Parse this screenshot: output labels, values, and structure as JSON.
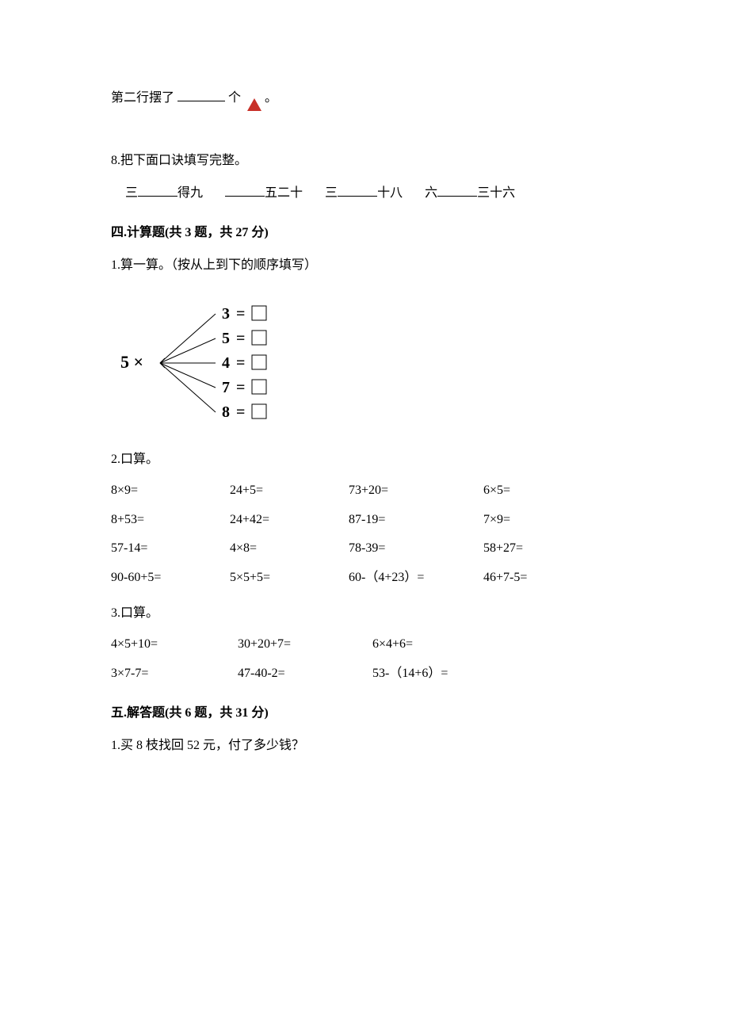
{
  "q7_tail": {
    "prefix": "第二行摆了",
    "suffix": "个",
    "period": "。"
  },
  "q8": {
    "prompt": "8.把下面口诀填写完整。",
    "items": [
      {
        "a": "三",
        "b": "得九"
      },
      {
        "a": "",
        "b": "五二十"
      },
      {
        "a": "三",
        "b": "十八"
      },
      {
        "a": "六",
        "b": "三十六"
      }
    ]
  },
  "sec4": {
    "title": "四.计算题(共 3 题，共 27 分)",
    "q1": {
      "prompt": "1.算一算。（按从上到下的顺序填写）",
      "left": "5 ×",
      "rows": [
        "3",
        "5",
        "4",
        "7",
        "8"
      ]
    },
    "q2": {
      "prompt": "2.口算。",
      "rows": [
        [
          "8×9=",
          "24+5=",
          "73+20=",
          "6×5="
        ],
        [
          "8+53=",
          "24+42=",
          "87-19=",
          "7×9="
        ],
        [
          "57-14=",
          "4×8=",
          "78-39=",
          "58+27="
        ],
        [
          "90-60+5=",
          "5×5+5=",
          "60-（4+23）=",
          "46+7-5="
        ]
      ]
    },
    "q3": {
      "prompt": "3.口算。",
      "rows": [
        [
          "4×5+10=",
          "30+20+7=",
          "6×4+6="
        ],
        [
          "3×7-7=",
          "47-40-2=",
          "53-（14+6）="
        ]
      ]
    }
  },
  "sec5": {
    "title": "五.解答题(共 6 题，共 31 分)",
    "q1": "1.买 8 枝找回 52 元，付了多少钱？"
  }
}
